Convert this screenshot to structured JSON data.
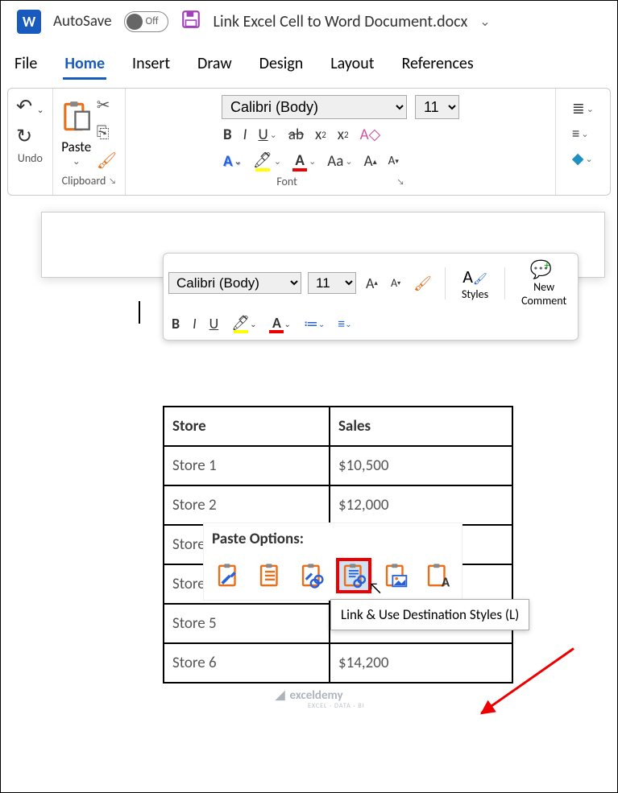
{
  "titlebar": {
    "autosave_label": "AutoSave",
    "autosave_state": "Off",
    "document_title": "Link Excel Cell to Word Document.docx"
  },
  "menu": {
    "items": [
      "File",
      "Home",
      "Insert",
      "Draw",
      "Design",
      "Layout",
      "References"
    ],
    "active": "Home"
  },
  "ribbon": {
    "undo_label": "Undo",
    "clipboard_label": "Clipboard",
    "paste_label": "Paste",
    "font_label": "Font",
    "font_name": "Calibri (Body)",
    "font_size": "11"
  },
  "mini_toolbar": {
    "font_name": "Calibri (Body)",
    "font_size": "11",
    "styles_label": "Styles",
    "new_comment_line1": "New",
    "new_comment_line2": "Comment"
  },
  "table": {
    "headers": [
      "Store",
      "Sales"
    ],
    "rows": [
      [
        "Store 1",
        "$10,500"
      ],
      [
        "Store 2",
        "$12,000"
      ],
      [
        "Store",
        ""
      ],
      [
        "Store",
        ""
      ],
      [
        "Store 5",
        ""
      ],
      [
        "Store 6",
        "$14,200"
      ]
    ]
  },
  "paste_options": {
    "title": "Paste Options:",
    "options": [
      {
        "name": "keep-source-formatting"
      },
      {
        "name": "use-destination-styles"
      },
      {
        "name": "link-keep-source-formatting"
      },
      {
        "name": "link-use-destination-styles"
      },
      {
        "name": "picture"
      },
      {
        "name": "keep-text-only"
      }
    ],
    "tooltip": "Link & Use Destination Styles (L)"
  },
  "watermark": {
    "text": "exceldemy",
    "sub": "EXCEL · DATA · BI"
  }
}
